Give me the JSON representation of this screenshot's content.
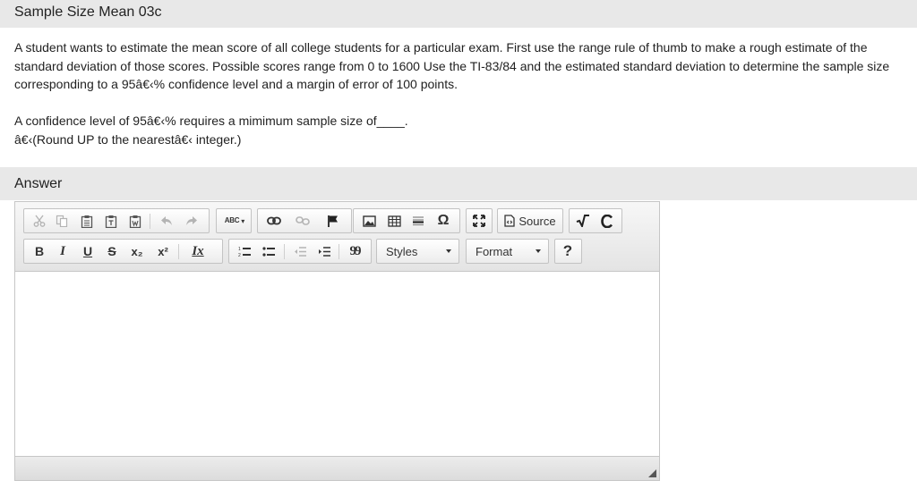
{
  "page": {
    "title": "Sample Size Mean 03c"
  },
  "question": {
    "text": "A student wants to estimate the mean score of all college students for a particular exam. First use the range rule of thumb to make a rough estimate of the standard deviation of those scores. Possible scores range from 0 to 1600  Use the TI-83/84 and the estimated standard deviation to determine the sample size corresponding to a 95â€‹% confidence level and a margin of error of 100 points.",
    "prompt_line1": "A confidence level of 95â€‹% requires a mimimum sample size of____.",
    "prompt_line2": "â€‹(Round UP to the nearestâ€‹ integer.)"
  },
  "answer": {
    "label": "Answer"
  },
  "editor": {
    "toolbar": {
      "source_label": "Source",
      "bold_label": "B",
      "italic_label": "I",
      "underline_label": "U",
      "strike_label": "S",
      "subscript_label": "x₂",
      "superscript_label": "x²",
      "remove_format_label": "Ix",
      "blockquote_label": "99",
      "styles_label": "Styles",
      "format_label": "Format",
      "help_label": "?",
      "omega_label": "Ω",
      "spell_label": "ABC"
    },
    "content": ""
  }
}
